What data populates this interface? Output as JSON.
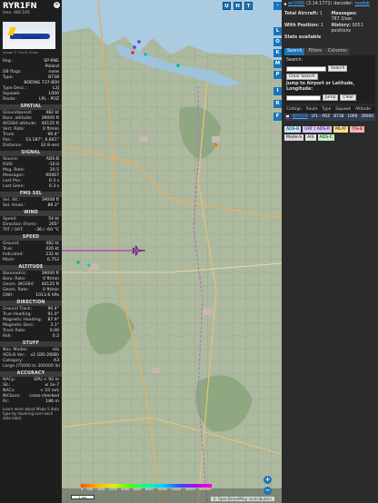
{
  "aircraft": {
    "callsign": "RYR1FN",
    "hex_label": "Hex:",
    "hex": "48C1A5",
    "close_icon": "close-icon",
    "photo_credit": "Image © Gerrit Griem",
    "reg_rows": [
      {
        "k": "Reg.:",
        "v": "SP-RNE"
      },
      {
        "k": "",
        "v": "Poland"
      },
      {
        "k": "DB flags:",
        "v": "none"
      },
      {
        "k": "Type:",
        "v": "B738"
      },
      {
        "k": "",
        "v": "BOEING 737-800"
      },
      {
        "k": "Type Desc.:",
        "v": "L2J"
      },
      {
        "k": "Squawk:",
        "v": "1000"
      },
      {
        "k": "Route:",
        "v": "LPL - POZ"
      }
    ]
  },
  "sections": {
    "spatial": {
      "title": "SPATIAL",
      "rows": [
        {
          "k": "Groundspeed:",
          "v": "482 kt"
        },
        {
          "k": "Baro. altitude:",
          "v": "39000 ft"
        },
        {
          "k": "WGS84 altitude:",
          "v": "40125 ft"
        },
        {
          "k": "Vert. Rate:",
          "v": "0 ft/min"
        },
        {
          "k": "Track:",
          "v": "90.4°"
        },
        {
          "k": "Pos.:",
          "v": "53.187°, 6.841°"
        },
        {
          "k": "Distance:",
          "v": "32.9 nmi"
        }
      ]
    },
    "signal": {
      "title": "SIGNAL",
      "rows": [
        {
          "k": "Source:",
          "v": "ADS-B"
        },
        {
          "k": "RSSI:",
          "v": "-10.0"
        },
        {
          "k": "Msg. Rate:",
          "v": "20.5"
        },
        {
          "k": "Messages:",
          "v": "60067"
        },
        {
          "k": "Last Pos.:",
          "v": "0.3 s"
        },
        {
          "k": "Last Seen:",
          "v": "0.3 s"
        }
      ]
    },
    "fms": {
      "title": "FMS SEL",
      "rows": [
        {
          "k": "Sel. Alt.:",
          "v": "39008 ft"
        },
        {
          "k": "Sel. Head.:",
          "v": "89.3°"
        }
      ]
    },
    "wind": {
      "title": "WIND",
      "rows": [
        {
          "k": "Speed:",
          "v": "54 kt"
        },
        {
          "k": "Direction (from):",
          "v": "265°"
        },
        {
          "k": "TAT / OAT:",
          "v": "-36 / -60 °C"
        }
      ]
    },
    "speed": {
      "title": "SPEED",
      "rows": [
        {
          "k": "Ground:",
          "v": "482 kt"
        },
        {
          "k": "True:",
          "v": "426 kt"
        },
        {
          "k": "Indicated:",
          "v": "232 kt"
        },
        {
          "k": "Mach:",
          "v": "0.752"
        }
      ]
    },
    "altitude": {
      "title": "ALTITUDE",
      "rows": [
        {
          "k": "Barometric:",
          "v": "39000 ft"
        },
        {
          "k": "Baro. Rate:",
          "v": "0 ft/min"
        },
        {
          "k": "Geom. WGS84:",
          "v": "40125 ft"
        },
        {
          "k": "Geom. Rate:",
          "v": "0 ft/min"
        },
        {
          "k": "QNH:",
          "v": "1013.6 hPa"
        }
      ]
    },
    "direction": {
      "title": "DIRECTION",
      "rows": [
        {
          "k": "Ground Track:",
          "v": "90.4°"
        },
        {
          "k": "True Heading:",
          "v": "91.0°"
        },
        {
          "k": "Magnetic Heading:",
          "v": "87.9°"
        },
        {
          "k": "Magnetic Decl.:",
          "v": "3.1°"
        },
        {
          "k": "Track Rate:",
          "v": "0.00"
        },
        {
          "k": "Roll:",
          "v": "0.2"
        }
      ]
    },
    "stuff": {
      "title": "STUFF",
      "rows": [
        {
          "k": "Nav. Modes:",
          "v": "n/a"
        },
        {
          "k": "ADS-B Ver.:",
          "v": "v2 (DO-260B)"
        },
        {
          "k": "Category:",
          "v": "A3"
        },
        {
          "k": "Large (75000 to 300000 lb)",
          "v": ""
        }
      ]
    },
    "accuracy": {
      "title": "ACCURACY",
      "rows": [
        {
          "k": "NACp:",
          "v": "EPU < 92 m"
        },
        {
          "k": "SIL:",
          "v": "≤ 1e-7"
        },
        {
          "k": "NACv:",
          "v": "< 10 m/s"
        },
        {
          "k": "NICbaro:",
          "v": "cross-checked"
        },
        {
          "k": "Rc:",
          "v": "186 m"
        }
      ]
    },
    "note": "Learn more about Mode S data type by hovering over each data label."
  },
  "map": {
    "buttons": [
      "U",
      "H",
      "T"
    ],
    "side_buttons": [
      "L",
      "O",
      "K",
      "M",
      "P",
      "I",
      "R",
      "F"
    ],
    "zoom_in": "+",
    "zoom_out": "−",
    "legend_labels": [
      "0",
      "500",
      "1000",
      "2000",
      "4000",
      "6000",
      "8000",
      "10000",
      "20000",
      "30000",
      "40000+"
    ],
    "scale_label": "1 km",
    "attribution": "© OpenStreetMap contributors."
  },
  "panel": {
    "arrow_icon": "chevron-left-icon",
    "user_link": "wr1090",
    "version": "(3.14.1772)",
    "decoder": "decoder:",
    "readsb": "readsb",
    "stats": [
      {
        "label": "Total Aircraft:",
        "value": "1"
      },
      {
        "label": "Messages:",
        "value": "787.3/sec"
      },
      {
        "label": "With Position:",
        "value": "1"
      },
      {
        "label": "History:",
        "value": "9051 positions"
      },
      {
        "label": "Stats available",
        "value": ""
      }
    ],
    "tabs": [
      "Search",
      "Filters",
      "Columns"
    ],
    "search_label": "Search:",
    "search_button": "Search",
    "clear_button": "Clear Search",
    "jump_label": "Jump to Airport or Latitude, Longitude:",
    "jump_button": "Jump",
    "clear2_button": "Clear",
    "table_headers": [
      "Callsign",
      "Route",
      "Type",
      "Squawk",
      "Altitude"
    ],
    "table_row": {
      "callsign": "RYR1FN",
      "route": "LPL - POZ",
      "type": "B738",
      "squawk": "1000",
      "altitude": "39000"
    },
    "chips": [
      {
        "label": "ADS-B",
        "color": "#c8e6ff"
      },
      {
        "label": "UAT / ADS-R",
        "color": "#d8c8ff"
      },
      {
        "label": "MLAT",
        "color": "#ffe08a"
      },
      {
        "label": "TIS-B",
        "color": "#ffb0b0"
      },
      {
        "label": "Mode-S",
        "color": "#d9d9d9"
      },
      {
        "label": "AIS",
        "color": "#e0e0e0"
      },
      {
        "label": "ADS-C",
        "color": "#c4f0c4"
      }
    ]
  }
}
